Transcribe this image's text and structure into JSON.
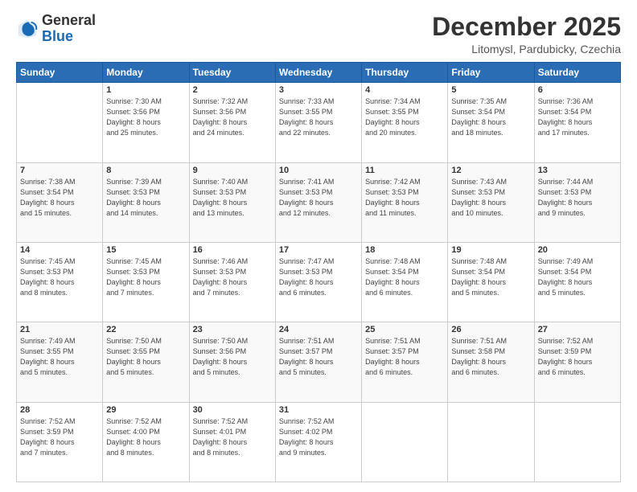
{
  "logo": {
    "general": "General",
    "blue": "Blue"
  },
  "header": {
    "month_title": "December 2025",
    "location": "Litomysl, Pardubicky, Czechia"
  },
  "weekdays": [
    "Sunday",
    "Monday",
    "Tuesday",
    "Wednesday",
    "Thursday",
    "Friday",
    "Saturday"
  ],
  "weeks": [
    [
      {
        "day": null,
        "info": null
      },
      {
        "day": "1",
        "info": "Sunrise: 7:30 AM\nSunset: 3:56 PM\nDaylight: 8 hours\nand 25 minutes."
      },
      {
        "day": "2",
        "info": "Sunrise: 7:32 AM\nSunset: 3:56 PM\nDaylight: 8 hours\nand 24 minutes."
      },
      {
        "day": "3",
        "info": "Sunrise: 7:33 AM\nSunset: 3:55 PM\nDaylight: 8 hours\nand 22 minutes."
      },
      {
        "day": "4",
        "info": "Sunrise: 7:34 AM\nSunset: 3:55 PM\nDaylight: 8 hours\nand 20 minutes."
      },
      {
        "day": "5",
        "info": "Sunrise: 7:35 AM\nSunset: 3:54 PM\nDaylight: 8 hours\nand 18 minutes."
      },
      {
        "day": "6",
        "info": "Sunrise: 7:36 AM\nSunset: 3:54 PM\nDaylight: 8 hours\nand 17 minutes."
      }
    ],
    [
      {
        "day": "7",
        "info": "Sunrise: 7:38 AM\nSunset: 3:54 PM\nDaylight: 8 hours\nand 15 minutes."
      },
      {
        "day": "8",
        "info": "Sunrise: 7:39 AM\nSunset: 3:53 PM\nDaylight: 8 hours\nand 14 minutes."
      },
      {
        "day": "9",
        "info": "Sunrise: 7:40 AM\nSunset: 3:53 PM\nDaylight: 8 hours\nand 13 minutes."
      },
      {
        "day": "10",
        "info": "Sunrise: 7:41 AM\nSunset: 3:53 PM\nDaylight: 8 hours\nand 12 minutes."
      },
      {
        "day": "11",
        "info": "Sunrise: 7:42 AM\nSunset: 3:53 PM\nDaylight: 8 hours\nand 11 minutes."
      },
      {
        "day": "12",
        "info": "Sunrise: 7:43 AM\nSunset: 3:53 PM\nDaylight: 8 hours\nand 10 minutes."
      },
      {
        "day": "13",
        "info": "Sunrise: 7:44 AM\nSunset: 3:53 PM\nDaylight: 8 hours\nand 9 minutes."
      }
    ],
    [
      {
        "day": "14",
        "info": "Sunrise: 7:45 AM\nSunset: 3:53 PM\nDaylight: 8 hours\nand 8 minutes."
      },
      {
        "day": "15",
        "info": "Sunrise: 7:45 AM\nSunset: 3:53 PM\nDaylight: 8 hours\nand 7 minutes."
      },
      {
        "day": "16",
        "info": "Sunrise: 7:46 AM\nSunset: 3:53 PM\nDaylight: 8 hours\nand 7 minutes."
      },
      {
        "day": "17",
        "info": "Sunrise: 7:47 AM\nSunset: 3:53 PM\nDaylight: 8 hours\nand 6 minutes."
      },
      {
        "day": "18",
        "info": "Sunrise: 7:48 AM\nSunset: 3:54 PM\nDaylight: 8 hours\nand 6 minutes."
      },
      {
        "day": "19",
        "info": "Sunrise: 7:48 AM\nSunset: 3:54 PM\nDaylight: 8 hours\nand 5 minutes."
      },
      {
        "day": "20",
        "info": "Sunrise: 7:49 AM\nSunset: 3:54 PM\nDaylight: 8 hours\nand 5 minutes."
      }
    ],
    [
      {
        "day": "21",
        "info": "Sunrise: 7:49 AM\nSunset: 3:55 PM\nDaylight: 8 hours\nand 5 minutes."
      },
      {
        "day": "22",
        "info": "Sunrise: 7:50 AM\nSunset: 3:55 PM\nDaylight: 8 hours\nand 5 minutes."
      },
      {
        "day": "23",
        "info": "Sunrise: 7:50 AM\nSunset: 3:56 PM\nDaylight: 8 hours\nand 5 minutes."
      },
      {
        "day": "24",
        "info": "Sunrise: 7:51 AM\nSunset: 3:57 PM\nDaylight: 8 hours\nand 5 minutes."
      },
      {
        "day": "25",
        "info": "Sunrise: 7:51 AM\nSunset: 3:57 PM\nDaylight: 8 hours\nand 6 minutes."
      },
      {
        "day": "26",
        "info": "Sunrise: 7:51 AM\nSunset: 3:58 PM\nDaylight: 8 hours\nand 6 minutes."
      },
      {
        "day": "27",
        "info": "Sunrise: 7:52 AM\nSunset: 3:59 PM\nDaylight: 8 hours\nand 6 minutes."
      }
    ],
    [
      {
        "day": "28",
        "info": "Sunrise: 7:52 AM\nSunset: 3:59 PM\nDaylight: 8 hours\nand 7 minutes."
      },
      {
        "day": "29",
        "info": "Sunrise: 7:52 AM\nSunset: 4:00 PM\nDaylight: 8 hours\nand 8 minutes."
      },
      {
        "day": "30",
        "info": "Sunrise: 7:52 AM\nSunset: 4:01 PM\nDaylight: 8 hours\nand 8 minutes."
      },
      {
        "day": "31",
        "info": "Sunrise: 7:52 AM\nSunset: 4:02 PM\nDaylight: 8 hours\nand 9 minutes."
      },
      {
        "day": null,
        "info": null
      },
      {
        "day": null,
        "info": null
      },
      {
        "day": null,
        "info": null
      }
    ]
  ]
}
